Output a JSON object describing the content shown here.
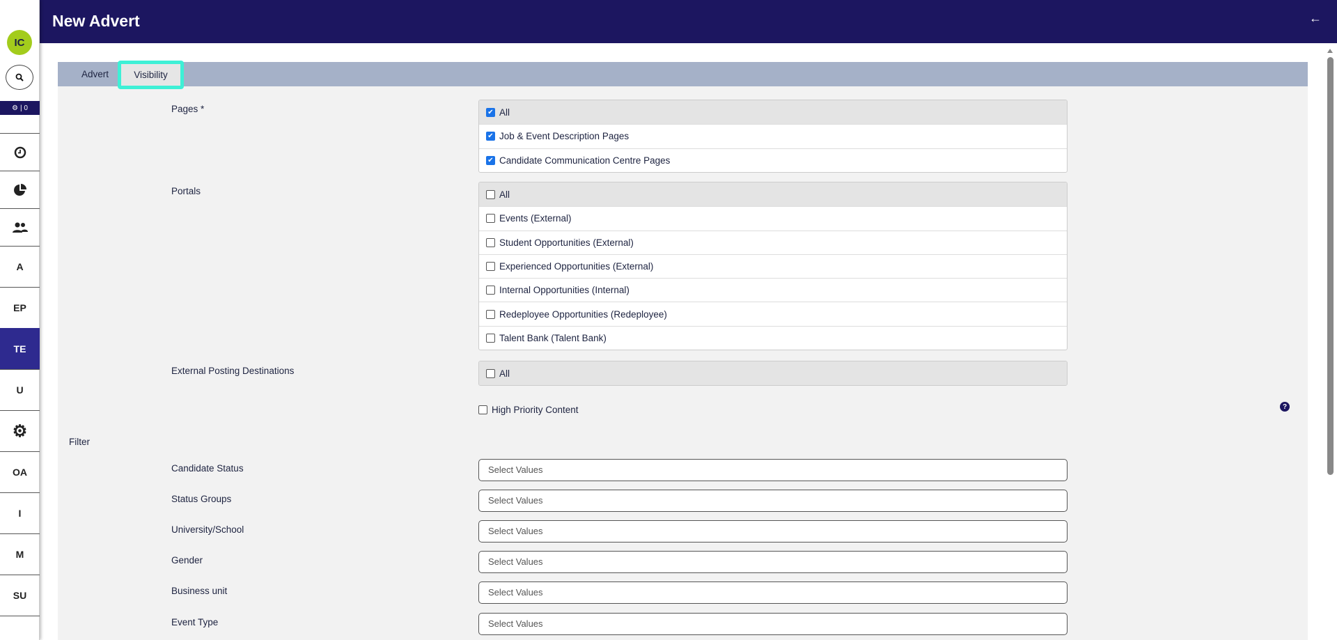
{
  "sidebar": {
    "avatar": "IC",
    "notifications": "| 0",
    "items": [
      {
        "label": "",
        "icon": "clock-icon"
      },
      {
        "label": "",
        "icon": "pie-chart-icon"
      },
      {
        "label": "",
        "icon": "users-icon"
      },
      {
        "label": "A"
      },
      {
        "label": "EP"
      },
      {
        "label": "TE",
        "active": true
      },
      {
        "label": "U"
      },
      {
        "label": "",
        "icon": "gear-icon"
      },
      {
        "label": "OA"
      },
      {
        "label": "I"
      },
      {
        "label": "M"
      },
      {
        "label": "SU"
      }
    ]
  },
  "header": {
    "title": "New Advert"
  },
  "tabs": [
    {
      "label": "Advert"
    },
    {
      "label": "Visibility"
    }
  ],
  "form": {
    "pages": {
      "label": "Pages *",
      "options": [
        {
          "label": "All",
          "checked": true
        },
        {
          "label": "Job & Event Description Pages",
          "checked": true
        },
        {
          "label": "Candidate Communication Centre Pages",
          "checked": true
        }
      ]
    },
    "portals": {
      "label": "Portals",
      "options": [
        {
          "label": "All",
          "checked": false
        },
        {
          "label": "Events (External)",
          "checked": false
        },
        {
          "label": "Student Opportunities (External)",
          "checked": false
        },
        {
          "label": "Experienced Opportunities (External)",
          "checked": false
        },
        {
          "label": "Internal Opportunities (Internal)",
          "checked": false
        },
        {
          "label": "Redeployee Opportunities (Redeployee)",
          "checked": false
        },
        {
          "label": "Talent Bank (Talent Bank)",
          "checked": false
        }
      ]
    },
    "external": {
      "label": "External Posting Destinations",
      "options": [
        {
          "label": "All",
          "checked": false
        }
      ]
    },
    "high_priority": {
      "label": "High Priority Content",
      "checked": false
    },
    "help": "?"
  },
  "filter": {
    "title": "Filter",
    "fields": [
      {
        "label": "Candidate Status",
        "placeholder": "Select Values"
      },
      {
        "label": "Status Groups",
        "placeholder": "Select Values"
      },
      {
        "label": "University/School",
        "placeholder": "Select Values"
      },
      {
        "label": "Gender",
        "placeholder": "Select Values"
      },
      {
        "label": "Business unit",
        "placeholder": "Select Values"
      },
      {
        "label": "Event Type",
        "placeholder": "Select Values"
      }
    ]
  }
}
